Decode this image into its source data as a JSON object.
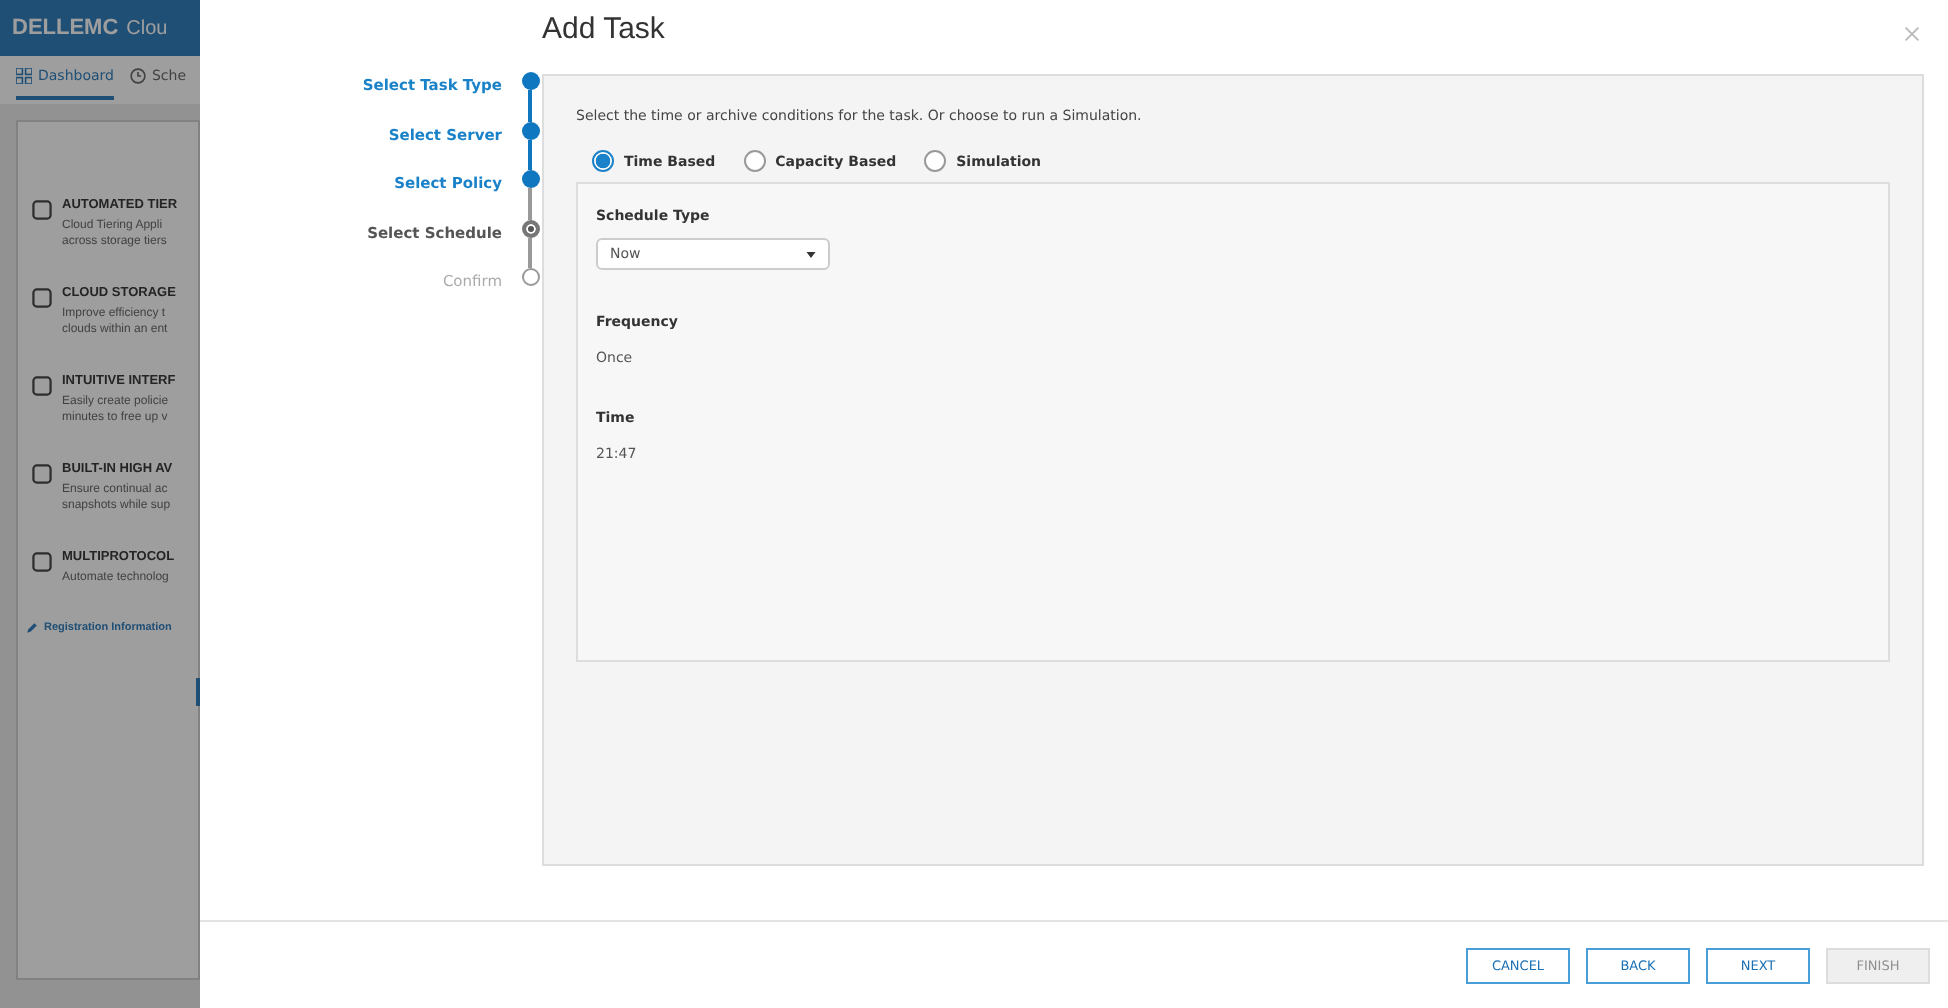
{
  "background_app": {
    "logo": "DELLEMC",
    "product": "Clou",
    "tabs": [
      {
        "label": "Dashboard",
        "selected": true
      },
      {
        "label": "Sche",
        "selected": false
      }
    ],
    "features": [
      {
        "title": "AUTOMATED TIER",
        "lines": [
          "Cloud Tiering Appli",
          "across storage tiers"
        ]
      },
      {
        "title": "CLOUD STORAGE",
        "lines": [
          "Improve efficiency t",
          "clouds within an ent"
        ]
      },
      {
        "title": "INTUITIVE INTERF",
        "lines": [
          "Easily create policie",
          "minutes to free up v"
        ]
      },
      {
        "title": "BUILT-IN HIGH AV",
        "lines": [
          "Ensure continual ac",
          "snapshots while sup"
        ]
      },
      {
        "title": "MULTIPROTOCOL",
        "lines": [
          "Automate technolog"
        ]
      }
    ],
    "link": "Registration Information"
  },
  "dialog": {
    "title": "Add Task",
    "steps": [
      {
        "label": "Select Task Type",
        "kind": "done"
      },
      {
        "label": "Select Server",
        "kind": "done"
      },
      {
        "label": "Select Policy",
        "kind": "done"
      },
      {
        "label": "Select Schedule",
        "kind": "current"
      },
      {
        "label": "Confirm",
        "kind": "pending"
      }
    ],
    "instruction": "Select the time or archive conditions for the task. Or choose to run a Simulation.",
    "options": [
      {
        "label": "Time Based",
        "selected": true
      },
      {
        "label": "Capacity Based",
        "selected": false
      },
      {
        "label": "Simulation",
        "selected": false
      }
    ],
    "schedule_type": {
      "label": "Schedule Type",
      "value": "Now"
    },
    "fields": [
      {
        "label": "Frequency",
        "value": "Once"
      },
      {
        "label": "Time",
        "value": "21:47"
      }
    ],
    "buttons": [
      {
        "label": "CANCEL",
        "disabled": false
      },
      {
        "label": "BACK",
        "disabled": false
      },
      {
        "label": "NEXT",
        "disabled": false
      },
      {
        "label": "FINISH",
        "disabled": true
      }
    ]
  }
}
